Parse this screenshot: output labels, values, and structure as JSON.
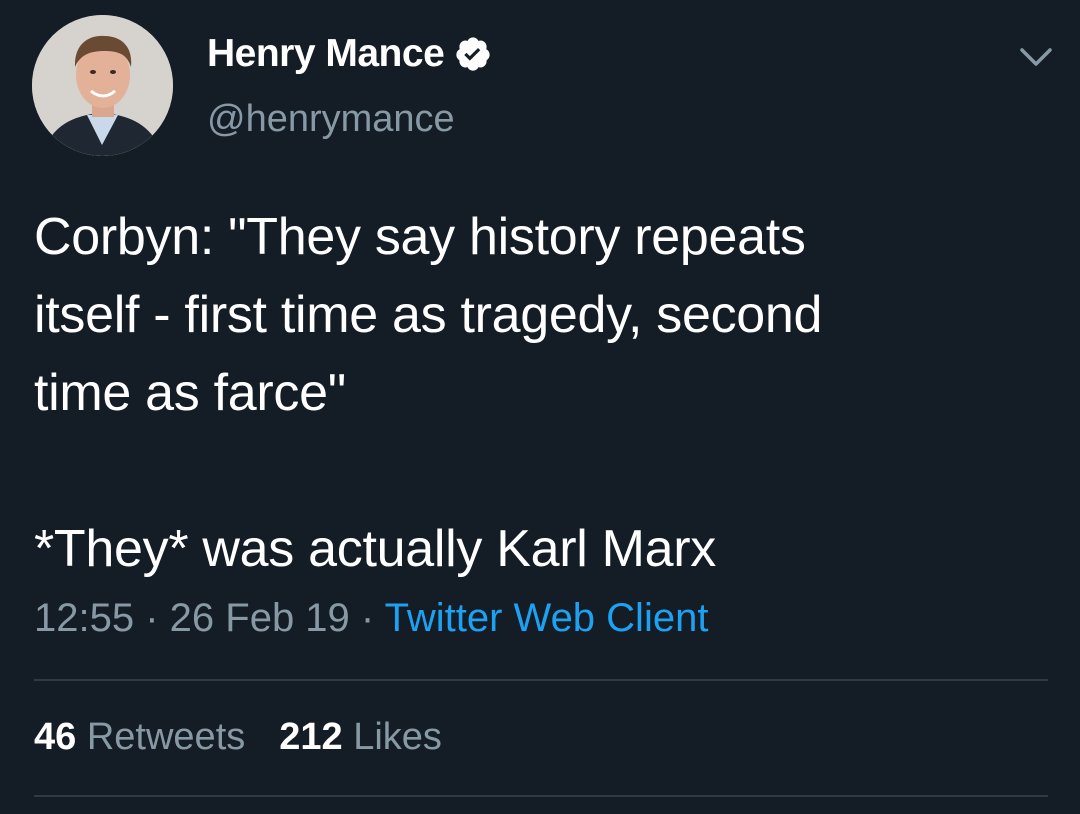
{
  "author": {
    "display_name": "Henry Mance",
    "handle": "@henrymance",
    "verified": true
  },
  "tweet": {
    "text_lines": [
      "Corbyn: \"They say history repeats",
      "itself - first time as tragedy, second",
      "time as farce\""
    ],
    "text_line_after_gap": "*They* was actually Karl Marx"
  },
  "meta": {
    "time": "12:55",
    "separator": " · ",
    "date": "26 Feb 19",
    "source": "Twitter Web Client"
  },
  "stats": {
    "retweets_count": "46",
    "retweets_label": "Retweets",
    "likes_count": "212",
    "likes_label": "Likes"
  },
  "colors": {
    "background": "#141d26",
    "primary_text": "#ffffff",
    "secondary_text": "#8899a6",
    "link": "#1da1f2",
    "divider": "#2f3a45"
  },
  "icons": {
    "verified": "verified-badge-icon",
    "chevron": "chevron-down-icon"
  }
}
